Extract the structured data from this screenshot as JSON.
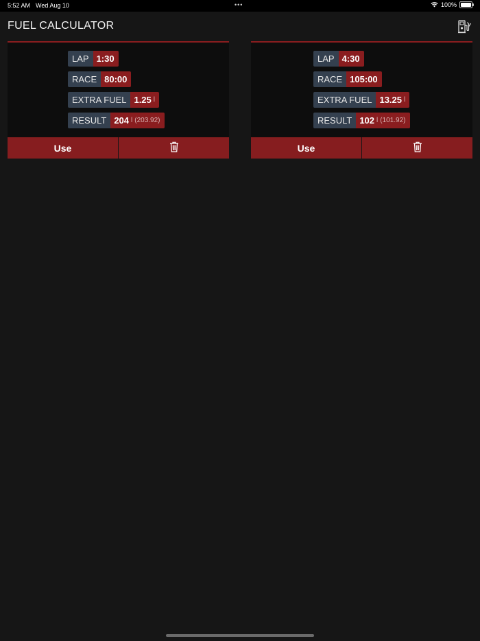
{
  "status_bar": {
    "time": "5:52 AM",
    "date": "Wed Aug 10",
    "dots": "•••",
    "battery": "100%"
  },
  "header": {
    "title": "FUEL CALCULATOR",
    "icon": "fuel-pump-icon"
  },
  "cards": [
    {
      "fields": [
        {
          "label": "LAP",
          "value": "1:30",
          "unit": "",
          "extra": ""
        },
        {
          "label": "RACE",
          "value": "80:00",
          "unit": "",
          "extra": ""
        },
        {
          "label": "EXTRA FUEL",
          "value": "1.25",
          "unit": "l",
          "extra": ""
        },
        {
          "label": "RESULT",
          "value": "204",
          "unit": "l",
          "extra": "(203.92)"
        }
      ],
      "use_label": "Use",
      "delete_icon": "trash-icon"
    },
    {
      "fields": [
        {
          "label": "LAP",
          "value": "4:30",
          "unit": "",
          "extra": ""
        },
        {
          "label": "RACE",
          "value": "105:00",
          "unit": "",
          "extra": ""
        },
        {
          "label": "EXTRA FUEL",
          "value": "13.25",
          "unit": "l",
          "extra": ""
        },
        {
          "label": "RESULT",
          "value": "102",
          "unit": "l",
          "extra": "(101.92)"
        }
      ],
      "use_label": "Use",
      "delete_icon": "trash-icon"
    }
  ],
  "colors": {
    "background": "#161616",
    "accent_red": "#8a1d1f",
    "label_slate": "#34404f"
  }
}
